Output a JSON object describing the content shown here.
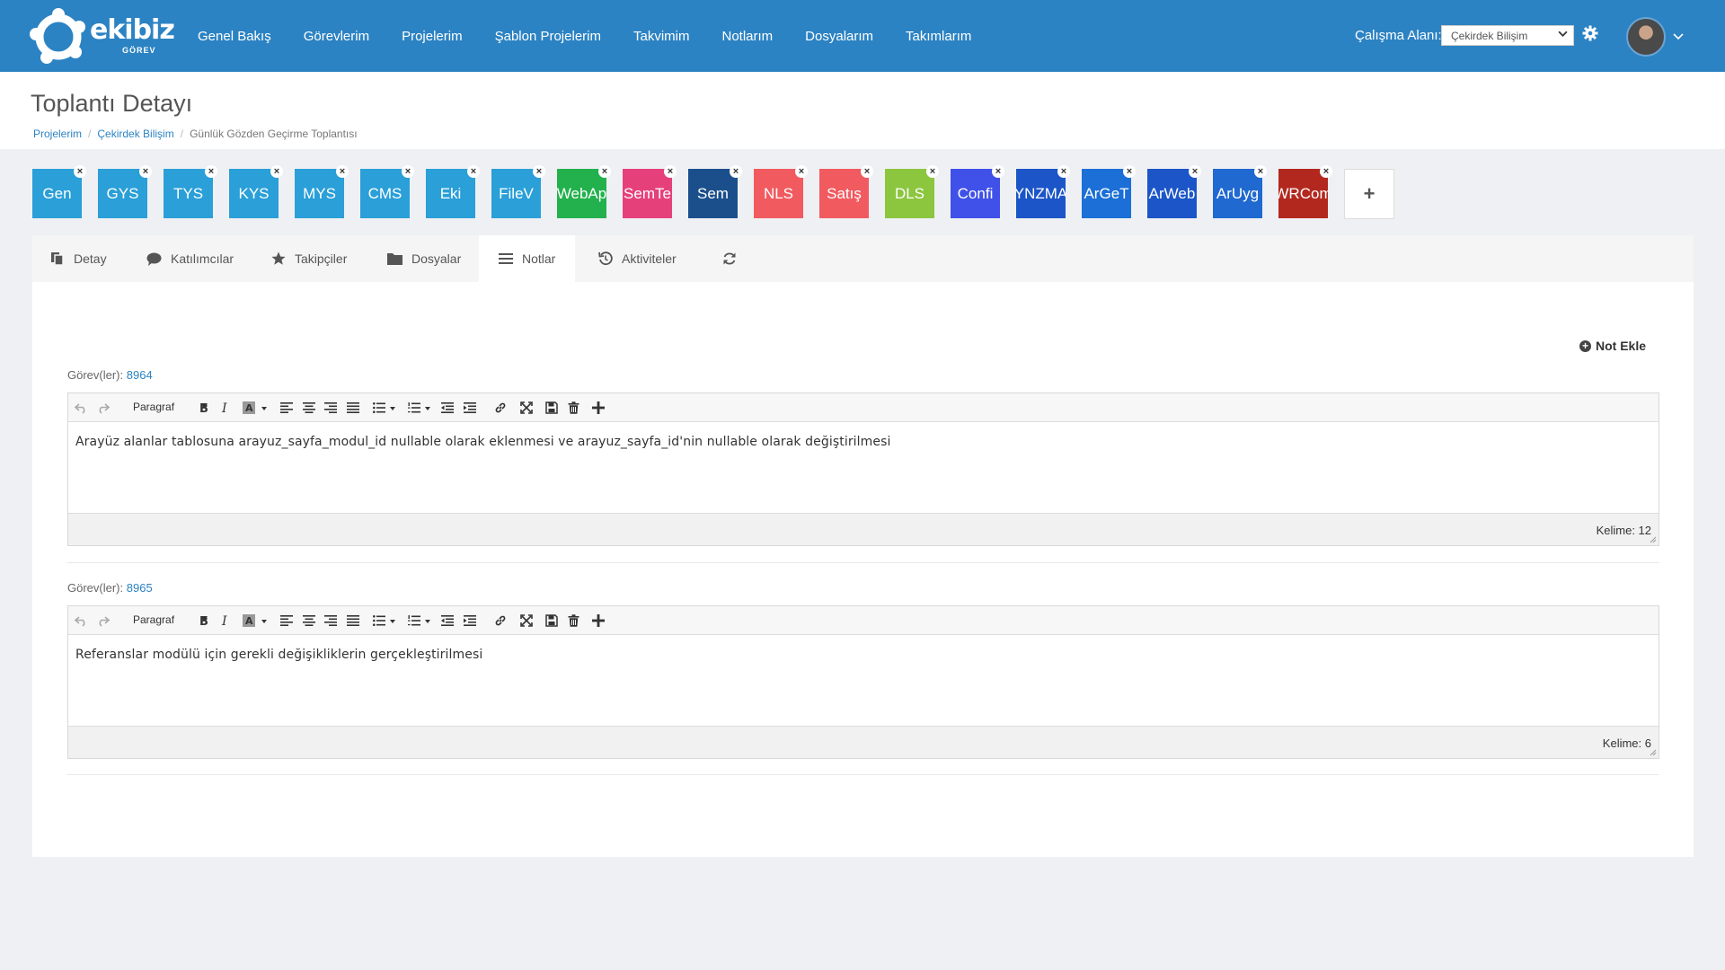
{
  "brand": {
    "name": "ekibiz",
    "sub": "GÖREV"
  },
  "nav": [
    {
      "label": "Genel Bakış"
    },
    {
      "label": "Görevlerim"
    },
    {
      "label": "Projelerim"
    },
    {
      "label": "Şablon Projelerim"
    },
    {
      "label": "Takvimim"
    },
    {
      "label": "Notlarım"
    },
    {
      "label": "Dosyalarım"
    },
    {
      "label": "Takımlarım"
    }
  ],
  "workspace": {
    "label": "Çalışma Alanı:",
    "value": "Çekirdek Bilişim"
  },
  "page": {
    "title": "Toplantı Detayı"
  },
  "breadcrumb": [
    "Projelerim",
    "Çekirdek Bilişim",
    "Günlük Gözden Geçirme Toplantısı"
  ],
  "projects": [
    {
      "label": "Gen",
      "color": "#2a9fd8"
    },
    {
      "label": "GYS",
      "color": "#2a9fd8"
    },
    {
      "label": "TYS",
      "color": "#2a9fd8"
    },
    {
      "label": "KYS",
      "color": "#2a9fd8"
    },
    {
      "label": "MYS",
      "color": "#2a9fd8"
    },
    {
      "label": "CMS",
      "color": "#2a9fd8"
    },
    {
      "label": "Eki",
      "color": "#2a9fd8"
    },
    {
      "label": "FileV",
      "color": "#2a9fd8"
    },
    {
      "label": "WebAp",
      "color": "#22b14c"
    },
    {
      "label": "SemTe",
      "color": "#e6407a"
    },
    {
      "label": "Sem",
      "color": "#1b4f8c"
    },
    {
      "label": "NLS",
      "color": "#f15a5f"
    },
    {
      "label": "Satış",
      "color": "#f15a5f"
    },
    {
      "label": "DLS",
      "color": "#8cc63f"
    },
    {
      "label": "Confi",
      "color": "#3f51e8"
    },
    {
      "label": "YNZMA",
      "color": "#1b55c8"
    },
    {
      "label": "ArGeT",
      "color": "#1b6fd6"
    },
    {
      "label": "ArWeb",
      "color": "#1b55c8"
    },
    {
      "label": "ArUyg",
      "color": "#2069d0"
    },
    {
      "label": "WRCom",
      "color": "#b3281e"
    }
  ],
  "tile_close": "×",
  "tile_add": "+",
  "tabs": [
    {
      "label": "Detay",
      "icon": "copy-icon"
    },
    {
      "label": "Katılımcılar",
      "icon": "comment-icon"
    },
    {
      "label": "Takipçiler",
      "icon": "star-icon"
    },
    {
      "label": "Dosyalar",
      "icon": "folder-icon"
    },
    {
      "label": "Notlar",
      "icon": "list-icon",
      "active": true
    },
    {
      "label": "Aktiviteler",
      "icon": "history-icon"
    },
    {
      "label": "",
      "icon": "refresh-icon"
    }
  ],
  "add_note": {
    "label": "Not Ekle"
  },
  "toolbar": {
    "paragraph": "Paragraf"
  },
  "notes": [
    {
      "task_label": "Görev(ler):",
      "task_id": "8964",
      "content": "Arayüz alanlar tablosuna arayuz_sayfa_modul_id nullable olarak eklenmesi ve arayuz_sayfa_id'nin nullable olarak değiştirilmesi",
      "word_count": "Kelime: 12"
    },
    {
      "task_label": "Görev(ler):",
      "task_id": "8965",
      "content": "Referanslar modülü için gerekli değişikliklerin gerçekleştirilmesi",
      "word_count": "Kelime: 6"
    }
  ]
}
